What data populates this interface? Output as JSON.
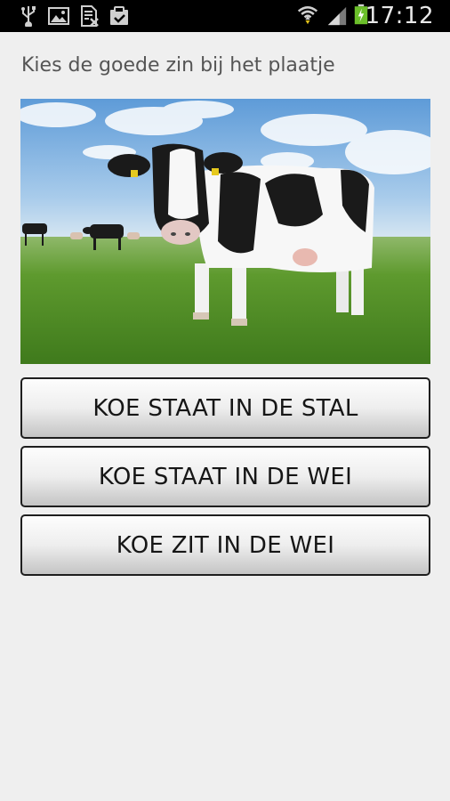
{
  "status_bar": {
    "time": "17:12",
    "left_icons": [
      "usb-icon",
      "image-icon",
      "document-x-icon",
      "clipboard-check-icon"
    ],
    "right_icons": [
      "wifi-icon",
      "signal-icon",
      "battery-charging-icon"
    ]
  },
  "quiz": {
    "prompt": "Kies de goede zin bij het plaatje",
    "image_subject": "cow-in-meadow-photo",
    "answers": [
      {
        "label": "KOE STAAT IN DE STAL"
      },
      {
        "label": "KOE STAAT IN DE WEI"
      },
      {
        "label": "KOE ZIT IN DE WEI"
      }
    ]
  },
  "colors": {
    "background": "#efefef",
    "status_bar": "#000000",
    "battery_green": "#6bbf2a",
    "button_border": "#1e1e1e"
  }
}
